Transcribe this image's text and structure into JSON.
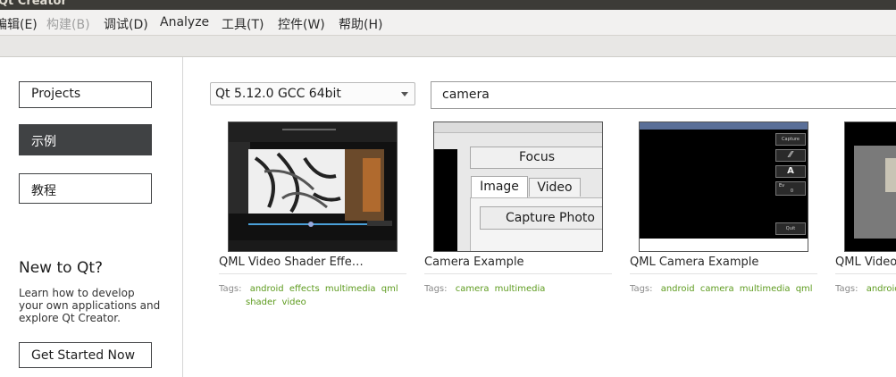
{
  "window": {
    "title": "Qt Creator"
  },
  "menubar": {
    "items": [
      {
        "label": "编辑(E)",
        "x": "0",
        "disabled": false
      },
      {
        "label": "构建(B)",
        "disabled": true
      },
      {
        "label": "调试(D)",
        "disabled": false
      },
      {
        "label": "Analyze",
        "disabled": false
      },
      {
        "label": "工具(T)",
        "disabled": false
      },
      {
        "label": "控件(W)",
        "disabled": false
      },
      {
        "label": "帮助(H)",
        "disabled": false
      }
    ]
  },
  "sidebar": {
    "projects": "Projects",
    "examples": "示例",
    "tutorials": "教程",
    "new_title": "New to Qt?",
    "new_desc": "Learn how to develop your own applications and explore Qt Creator.",
    "get_started": "Get Started Now"
  },
  "main": {
    "kit_selected": "Qt 5.12.0 GCC 64bit",
    "search_value": "camera",
    "tags_label": "Tags:",
    "examples": [
      {
        "title": "QML Video Shader Effe…",
        "tags_line1": [
          "android",
          "effects",
          "multimedia",
          "qml"
        ],
        "tags_line2": [
          "shader",
          "video"
        ]
      },
      {
        "title": "Camera Example",
        "tags_line1": [
          "camera",
          "multimedia"
        ],
        "tags_line2": [],
        "thumb": {
          "focus": "Focus",
          "tab_image": "Image",
          "tab_video": "Video",
          "capture": "Capture Photo"
        }
      },
      {
        "title": "QML Camera Example",
        "tags_line1": [
          "android",
          "camera",
          "multimedia",
          "qml"
        ],
        "tags_line2": [],
        "thumb": {
          "btn_capture": "Capture",
          "btn_a": "A",
          "btn_ev": "Ev",
          "btn_ev_val": "0",
          "btn_quit": "Quit"
        }
      },
      {
        "title": "QML Video",
        "tags_line1": [
          "android"
        ],
        "tags_line2": []
      }
    ]
  },
  "colors": {
    "accent_tag": "#5d9b1e",
    "active_nav": "#404244",
    "titlebar": "#3c3b37"
  }
}
